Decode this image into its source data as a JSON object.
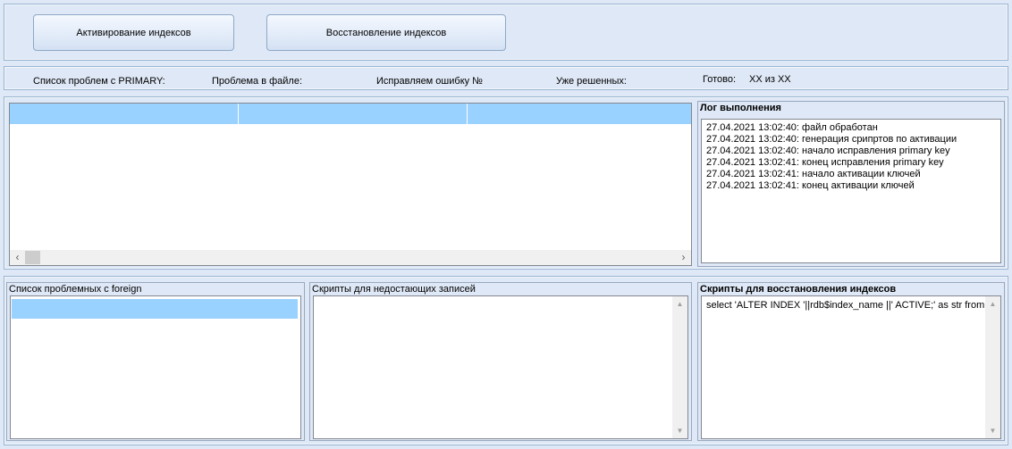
{
  "toolbar": {
    "activate_label": "Активирование индексов",
    "restore_label": "Восстановление индексов"
  },
  "status": {
    "primary_list_label": "Список проблем с PRIMARY:",
    "file_problem_label": "Проблема в файле:",
    "fixing_error_label": "Исправляем ошибку №",
    "solved_label": "Уже решенных:",
    "ready_label": "Готово:",
    "ready_value": "XX из XX"
  },
  "log": {
    "title": "Лог выполнения",
    "lines": [
      "27.04.2021 13:02:40: файл обработан",
      "27.04.2021 13:02:40: генерация срипртов по активации",
      "27.04.2021 13:02:40: начало исправления primary key",
      "27.04.2021 13:02:41: конец исправления primary key",
      "27.04.2021 13:02:41: начало активации ключей",
      "27.04.2021 13:02:41: конец активации ключей"
    ]
  },
  "foreign": {
    "title": "Список проблемных с foreign"
  },
  "missing_scripts": {
    "title": "Скрипты для недостающих записей",
    "text": ""
  },
  "restore_scripts": {
    "title": "Скрипты для восстановления индексов",
    "text": "select 'ALTER INDEX '||rdb$index_name ||' ACTIVE;' as str from r"
  },
  "icons": {
    "scroll_left": "chevron-left-icon",
    "scroll_right": "chevron-right-icon",
    "scroll_up": "triangle-up-icon",
    "scroll_down": "triangle-down-icon"
  }
}
